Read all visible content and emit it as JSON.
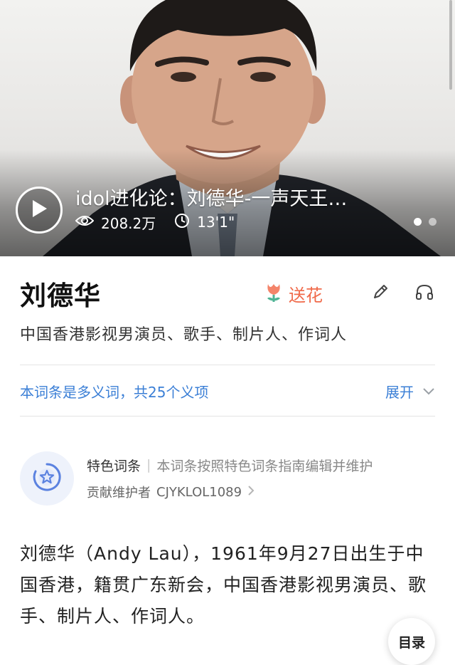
{
  "hero": {
    "video_title": "idol进化论：刘德华-一声天王…",
    "views": "208.2万",
    "duration": "13'1\"",
    "slides": 2,
    "active_slide": 1
  },
  "entry": {
    "title": "刘德华",
    "flower_label": "送花",
    "subtitle": "中国香港影视男演员、歌手、制片人、作词人"
  },
  "polysemy": {
    "text": "本词条是多义词，共25个义项",
    "expand_label": "展开"
  },
  "feature": {
    "tag": "特色词条",
    "desc": "本词条按照特色词条指南编辑并维护",
    "contributor_label": "贡献维护者",
    "contributor": "CJYKLOL1089"
  },
  "intro": {
    "text": "刘德华（Andy Lau），1961年9月27日出生于中国香港，籍贯广东新会，中国香港影视男演员、歌手、制片人、作词人。"
  },
  "toc": {
    "label": "目录"
  },
  "colors": {
    "accent_blue": "#3b7fd6",
    "flower_orange": "#f06a4a"
  },
  "icons": [
    "play-icon",
    "eye-icon",
    "clock-icon",
    "flower-icon",
    "edit-icon",
    "headphones-icon",
    "chevron-down-icon",
    "featured-star-icon",
    "chevron-right-icon"
  ]
}
